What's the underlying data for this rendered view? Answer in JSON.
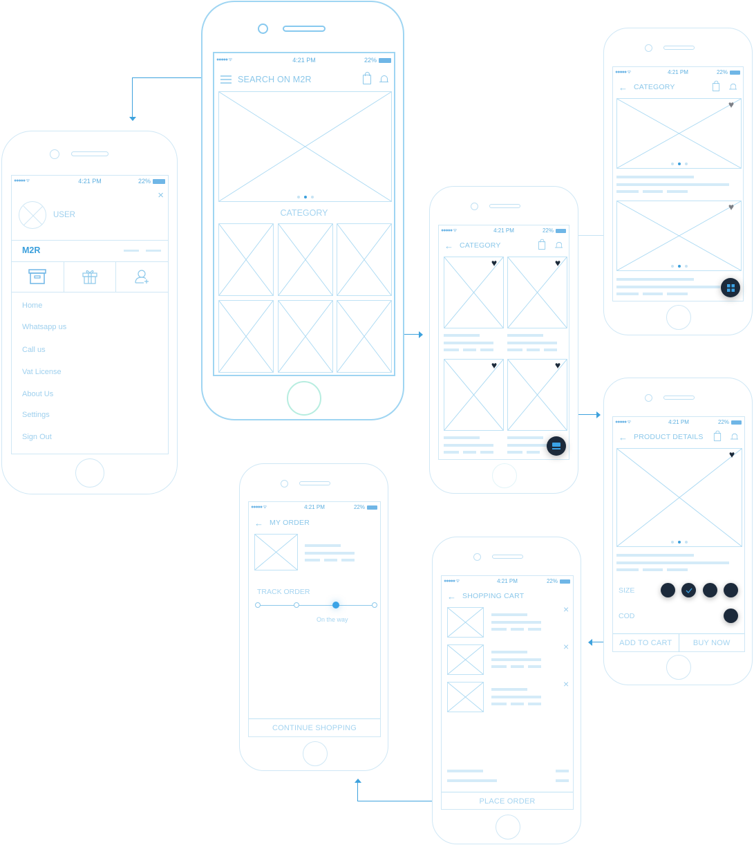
{
  "status_bar": {
    "signal": "●●●●● ᯤ",
    "time": "4:21 PM",
    "battery": "22%"
  },
  "colors": {
    "accent": "#3ea2dd",
    "wire": "#8cc8ea",
    "dark": "#1c2a3b",
    "placeholder_bar": "#d4ebf8"
  },
  "drawer_screen": {
    "user_label": "USER",
    "close_icon": "×",
    "brand": "M2R",
    "quick_icons": [
      "archive-box-icon",
      "gift-icon",
      "add-user-icon"
    ],
    "menu_items": [
      "Home",
      "Whatsapp us",
      "Call us",
      "Vat License",
      "About Us",
      "Settings",
      "Sign Out"
    ]
  },
  "home_screen": {
    "search_placeholder": "SEARCH ON M2R",
    "section_title": "CATEGORY",
    "carousel_active_dot": 2,
    "carousel_dots": 3
  },
  "category_grid_screen": {
    "title": "CATEGORY",
    "back_icon": "←"
  },
  "category_list_screen": {
    "title": "CATEGORY",
    "back_icon": "←"
  },
  "product_details_screen": {
    "title": "PRODUCT DETAILS",
    "back_icon": "←",
    "size_label": "SIZE",
    "size_options": 4,
    "selected_size_index": 2,
    "cod_label": "COD",
    "add_to_cart": "ADD TO CART",
    "buy_now": "BUY NOW"
  },
  "cart_screen": {
    "title": "SHOPPING CART",
    "back_icon": "←",
    "item_count": 3,
    "remove_icon": "×",
    "place_order": "PLACE ORDER"
  },
  "order_screen": {
    "title": "MY ORDER",
    "back_icon": "←",
    "track_label": "TRACK ORDER",
    "steps": 4,
    "current_step": 3,
    "current_status": "On the way",
    "continue_shopping": "CONTINUE SHOPPING"
  }
}
